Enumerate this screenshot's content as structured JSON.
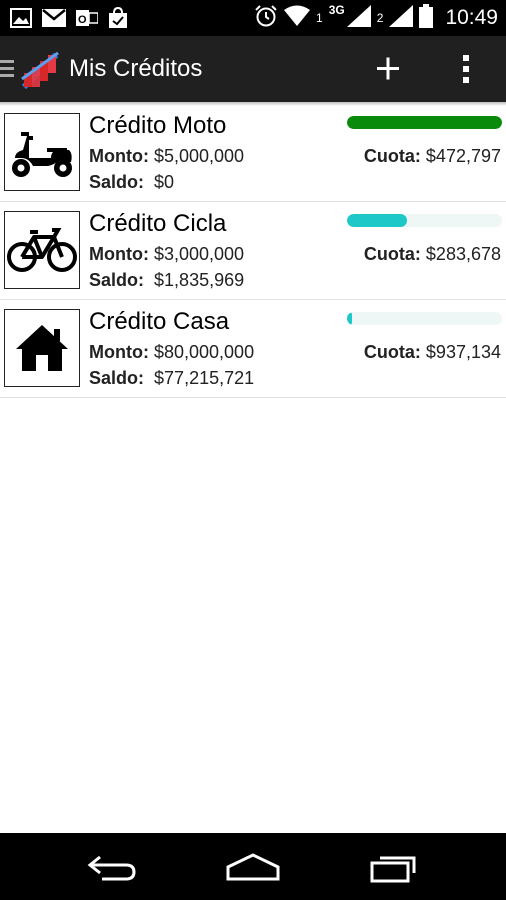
{
  "status_bar": {
    "time": "10:49",
    "network_type": "3G",
    "sim1_label": "1",
    "sim2_label": "2",
    "icons": [
      "image-icon",
      "gmail-icon",
      "outlook-icon",
      "shopping-icon",
      "alarm-icon",
      "wifi-icon",
      "signal-icon",
      "signal-icon",
      "battery-icon"
    ]
  },
  "action_bar": {
    "title": "Mis Créditos",
    "add_icon": "plus-icon",
    "menu_icon": "overflow-menu-icon"
  },
  "labels": {
    "monto": "Monto:",
    "saldo": "Saldo:",
    "cuota": "Cuota:"
  },
  "credits": [
    {
      "name": "Crédito Moto",
      "icon": "scooter-icon",
      "monto": "$5,000,000",
      "saldo": "$0",
      "cuota": "$472,797",
      "progress": 1.0,
      "progress_color": "#0a8a0a"
    },
    {
      "name": "Crédito Cicla",
      "icon": "bicycle-icon",
      "monto": "$3,000,000",
      "saldo": "$1,835,969",
      "cuota": "$283,678",
      "progress": 0.39,
      "progress_color": "#1ec8c8"
    },
    {
      "name": "Crédito Casa",
      "icon": "house-icon",
      "monto": "$80,000,000",
      "saldo": "$77,215,721",
      "cuota": "$937,134",
      "progress": 0.035,
      "progress_color": "#1ec8c8"
    }
  ],
  "nav_bar": {
    "buttons": [
      "back-icon",
      "home-icon",
      "recent-apps-icon"
    ]
  }
}
